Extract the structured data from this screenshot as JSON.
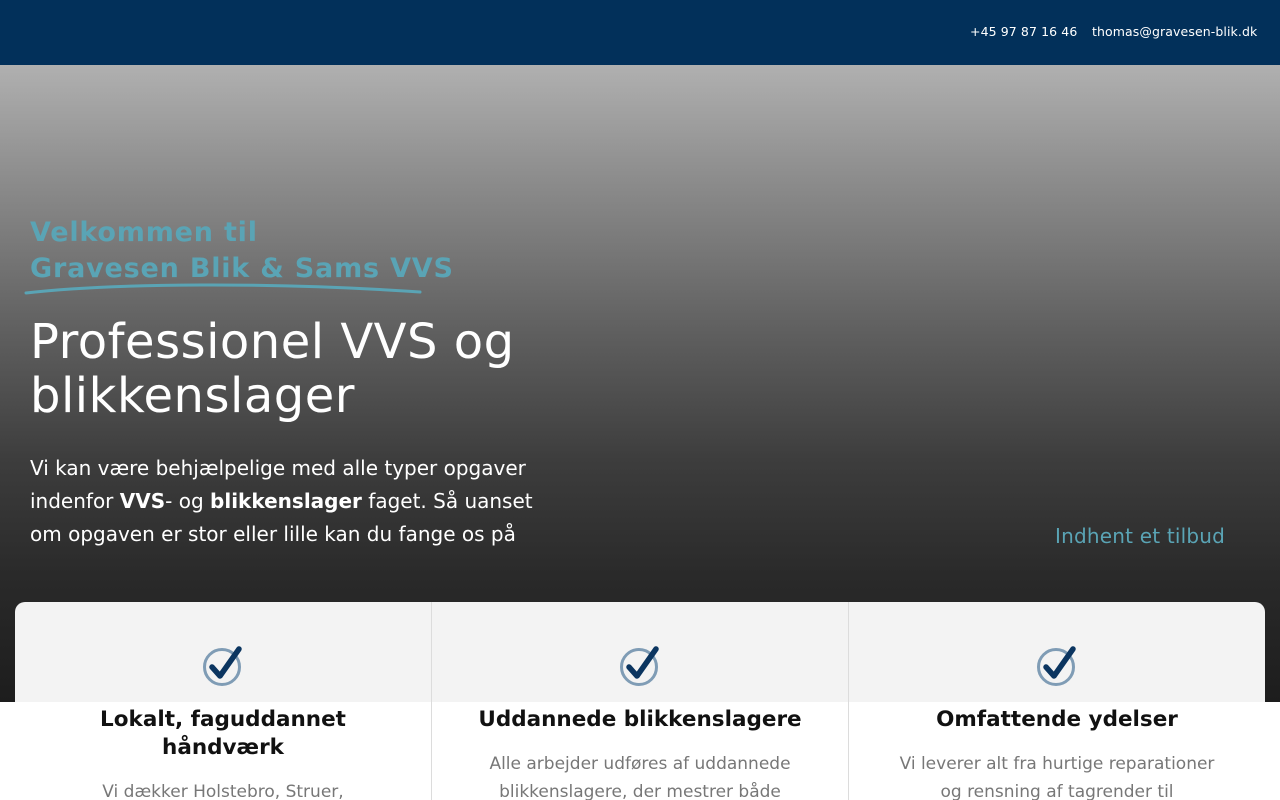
{
  "topbar": {
    "phone": "+45 97 87 16 46",
    "email": "thomas@gravesen-blik.dk"
  },
  "hero": {
    "welcome_line1": "Velkommen til",
    "welcome_line2": "Gravesen Blik & Sams VVS",
    "title": "Professionel VVS og blikkenslager",
    "desc_part1": "Vi kan være behjælpelige med alle typer opgaver indenfor ",
    "desc_bold1": "VVS",
    "desc_part2": "- og ",
    "desc_bold2": "blikkenslager",
    "desc_part3": " faget. Så uanset om opgaven er stor eller lille kan du fange os på",
    "cta_label": "Indhent et tilbud"
  },
  "features": [
    {
      "icon": "check-icon",
      "title": "Lokalt, faguddannet håndværk",
      "text": "Vi dækker Holstebro, Struer, Thyholm"
    },
    {
      "icon": "check-icon",
      "title": "Uddannede blikkenslagere",
      "text": "Alle arbejder udføres af uddannede blikkenslagere, der mestrer både"
    },
    {
      "icon": "check-icon",
      "title": "Omfattende ydelser",
      "text": "Vi leverer alt fra hurtige reparationer og rensning af tagrender til etablering af"
    }
  ],
  "colors": {
    "topbar": "#02305a",
    "accent": "#5aa4b5",
    "check_navy": "#0b3560",
    "check_ring": "#7f9cb5"
  }
}
